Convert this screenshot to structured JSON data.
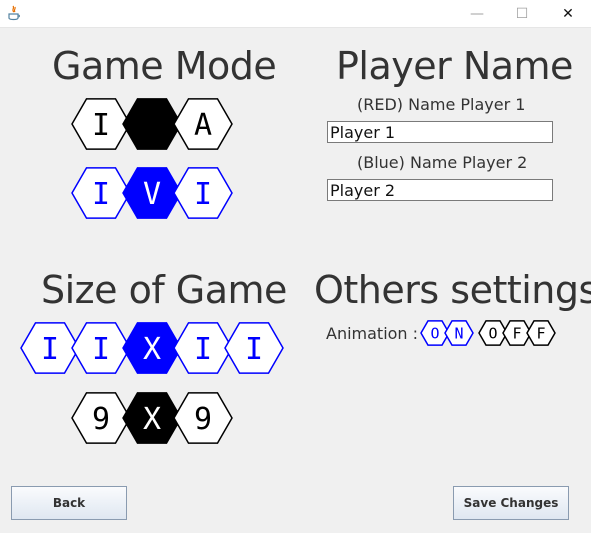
{
  "window": {
    "minimize_glyph": "—",
    "maximize_glyph": "☐",
    "close_glyph": "✕"
  },
  "game_mode": {
    "title": "Game Mode",
    "player_options": [
      "I",
      "",
      "A"
    ],
    "versus_options": [
      "I",
      "V",
      "I"
    ]
  },
  "player_name": {
    "title": "Player Name",
    "player1_label": "(RED) Name Player 1",
    "player1_value": "Player 1",
    "player2_label": "(Blue) Name Player 2",
    "player2_value": "Player 2"
  },
  "size_of_game": {
    "title": "Size of Game",
    "top_row": [
      "I",
      "I",
      "X",
      "I",
      "I"
    ],
    "bottom_row": [
      "9",
      "X",
      "9"
    ]
  },
  "others_settings": {
    "title": "Others settings",
    "animation_label": "Animation :",
    "on_letters": [
      "O",
      "N"
    ],
    "off_letters": [
      "O",
      "F",
      "F"
    ]
  },
  "buttons": {
    "back": "Back",
    "save": "Save Changes"
  },
  "colors": {
    "blue": "#0000ff",
    "black": "#000000",
    "background": "#f0f0f0"
  }
}
